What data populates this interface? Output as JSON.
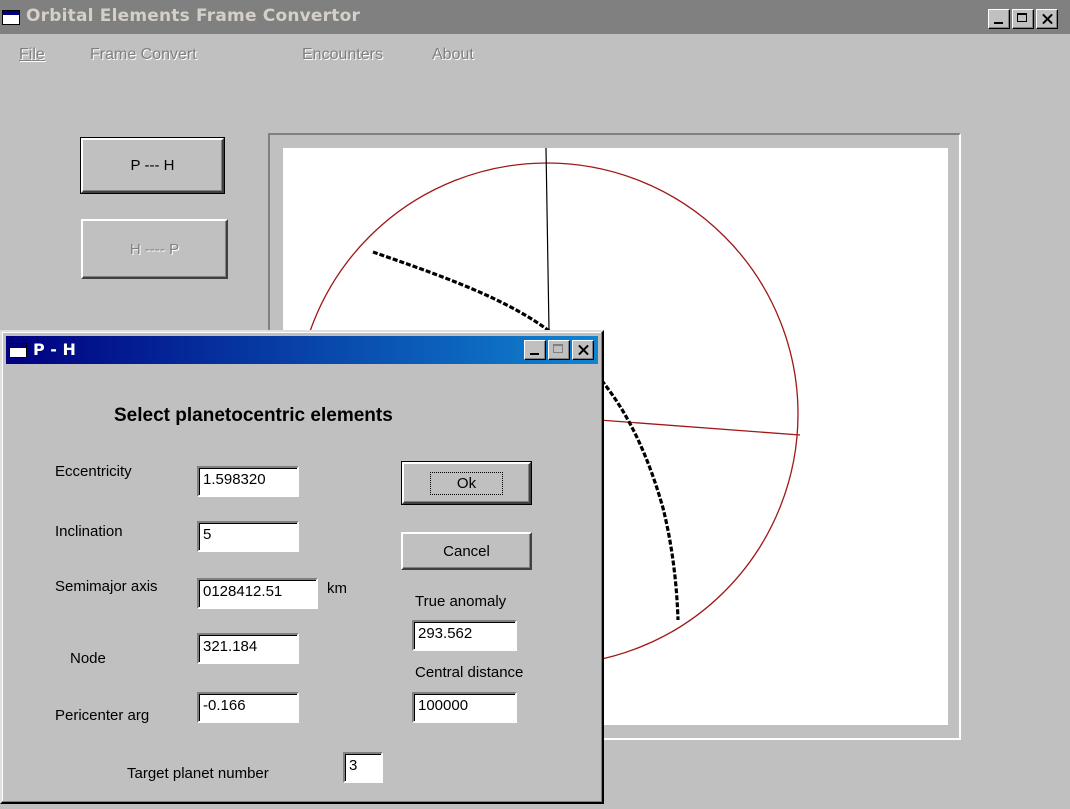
{
  "window": {
    "title": "Orbital Elements Frame Convertor"
  },
  "menu": {
    "file": "File",
    "frame_convert": "Frame Convert",
    "encounters": "Encounters",
    "about": "About"
  },
  "side_buttons": {
    "p_h": "P --- H",
    "h_p": "H ---- P"
  },
  "dialog": {
    "title": "P - H",
    "heading": "Select  planetocentric elements",
    "eccentricity_label": "Eccentricity",
    "eccentricity_value": "1.598320",
    "inclination_label": "Inclination",
    "inclination_value": "5",
    "semimajor_label": "Semimajor axis",
    "semimajor_value": "0128412.51",
    "semimajor_unit": "km",
    "node_label": "Node",
    "node_value": "321.184",
    "pericenter_label": "Pericenter arg",
    "pericenter_value": "-0.166",
    "target_label": "Target planet number",
    "target_value": "3",
    "ok_label": "Ok",
    "cancel_label": "Cancel",
    "true_anomaly_label": "True anomaly",
    "true_anomaly_value": "293.562",
    "central_distance_label": "Central distance",
    "central_distance_value": "100000"
  },
  "colors": {
    "desktop": "#c0c0c0",
    "circle": "#a01818",
    "trajectory": "#000000",
    "active_title_start": "#000080",
    "active_title_end": "#1084d0",
    "inactive_title": "#808080"
  }
}
